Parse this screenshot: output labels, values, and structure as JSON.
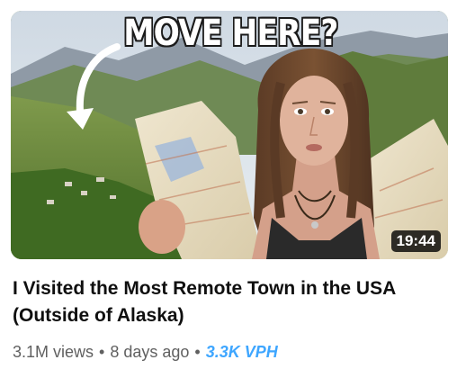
{
  "video": {
    "thumbnail_headline": "MOVE HERE?",
    "duration": "19:44",
    "title": "I Visited the Most Remote Town in the USA (Outside of Alaska)",
    "views": "3.1M views",
    "separator": "•",
    "age": "8 days ago",
    "vph": "3.3K VPH"
  },
  "colors": {
    "vph_accent": "#3ea6ff",
    "meta_text": "#606060",
    "title_text": "#0f0f0f"
  }
}
